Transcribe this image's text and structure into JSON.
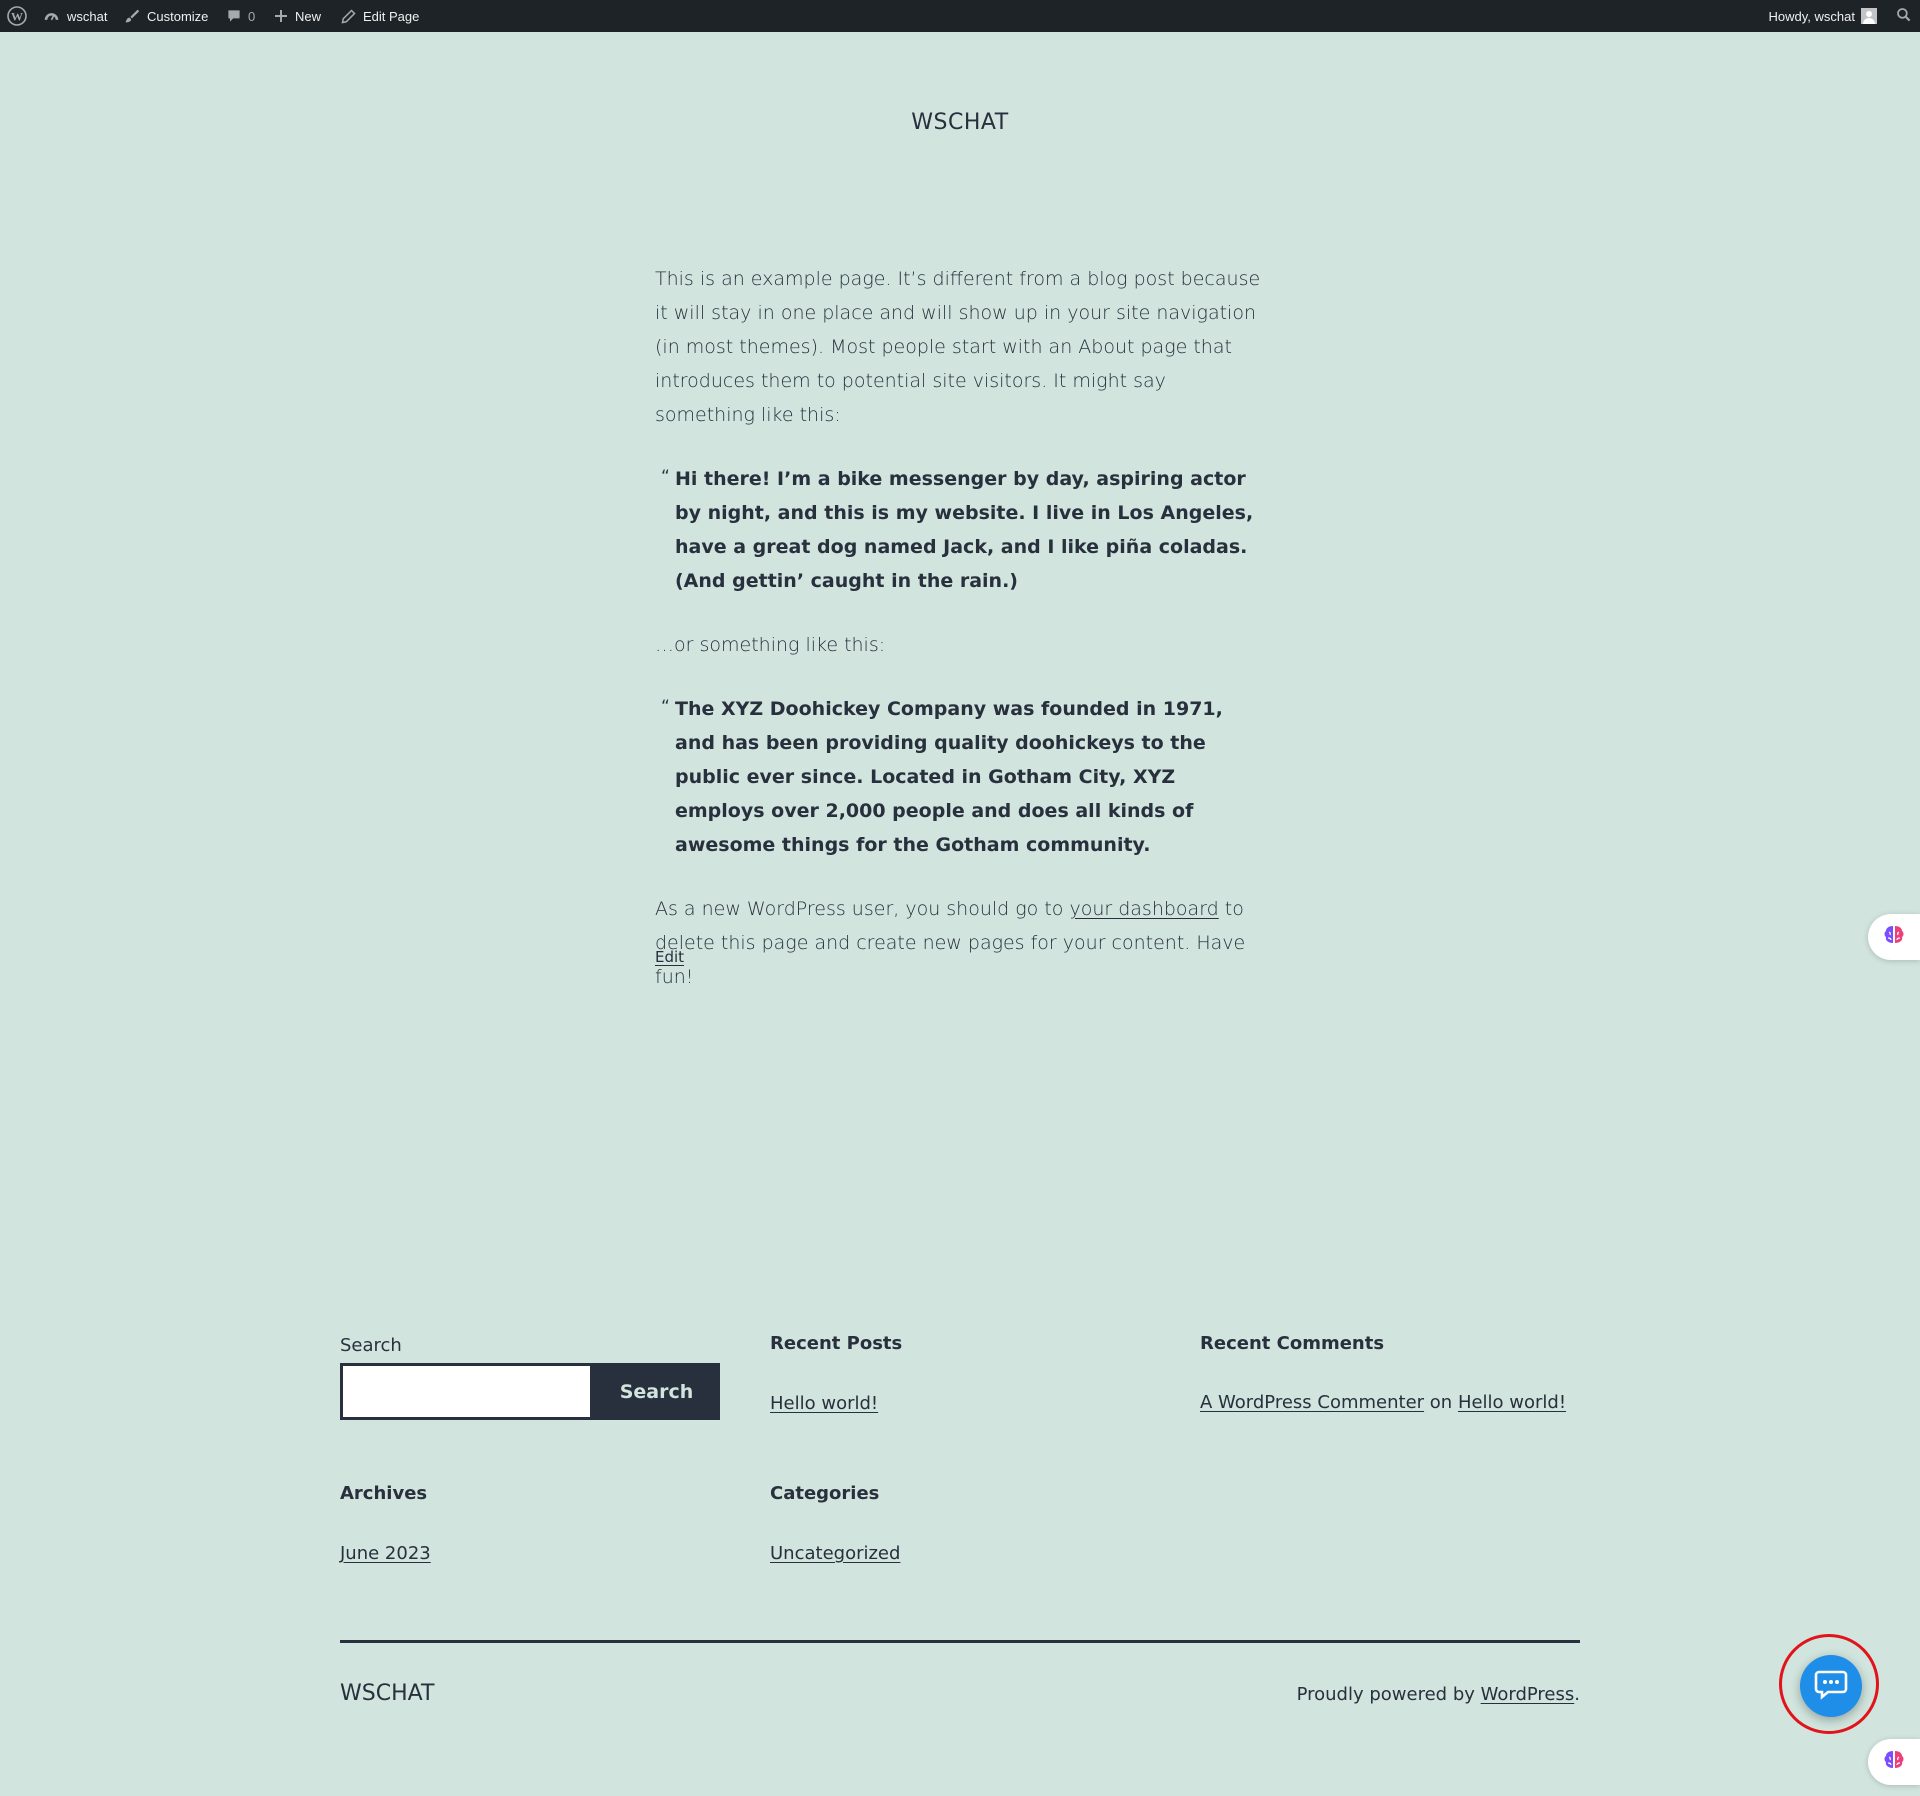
{
  "admin_bar": {
    "site_name": "wschat",
    "customize_label": "Customize",
    "comments_count": "0",
    "new_label": "New",
    "edit_page_label": "Edit Page",
    "howdy": "Howdy, wschat"
  },
  "header": {
    "site_title": "WSCHAT"
  },
  "content": {
    "intro": "This is an example page. It’s different from a blog post because it will stay in one place and will show up in your site navigation (in most themes). Most people start with an About page that introduces them to potential site visitors. It might say something like this:",
    "quote1": "Hi there! I’m a bike messenger by day, aspiring actor by night, and this is my website. I live in Los Angeles, have a great dog named Jack, and I like piña coladas. (And gettin’ caught in the rain.)",
    "middle": "…or something like this:",
    "quote2": "The XYZ Doohickey Company was founded in 1971, and has been providing quality doohickeys to the public ever since. Located in Gotham City, XYZ employs over 2,000 people and does all kinds of awesome things for the Gotham community.",
    "outro_before": "As a new WordPress user, you should go to ",
    "outro_link": "your dashboard",
    "outro_after": " to delete this page and create new pages for your content. Have fun!",
    "edit_link": "Edit"
  },
  "widgets": {
    "search": {
      "label": "Search",
      "button": "Search",
      "value": ""
    },
    "recent_posts": {
      "title": "Recent Posts",
      "items": [
        "Hello world!"
      ]
    },
    "recent_comments": {
      "title": "Recent Comments",
      "author": "A WordPress Commenter",
      "on": " on ",
      "post": "Hello world!"
    },
    "archives": {
      "title": "Archives",
      "items": [
        "June 2023"
      ]
    },
    "categories": {
      "title": "Categories",
      "items": [
        "Uncategorized"
      ]
    }
  },
  "footer": {
    "site_title": "WSCHAT",
    "powered_prefix": "Proudly powered by ",
    "powered_link": "WordPress",
    "powered_suffix": "."
  },
  "icons": {
    "wordpress": "wordpress-logo-icon",
    "dashboard": "dashboard-icon",
    "brush": "brush-icon",
    "comment": "comment-icon",
    "plus": "plus-icon",
    "pencil": "pencil-icon",
    "search": "search-icon",
    "brain": "brain-icon",
    "chat": "chat-bubble-icon"
  },
  "colors": {
    "background": "#d1e4dd",
    "text": "#28303d",
    "admin_bar": "#1d2327",
    "chat_button": "#1e8ee8",
    "highlight_ring": "#e0141a"
  }
}
